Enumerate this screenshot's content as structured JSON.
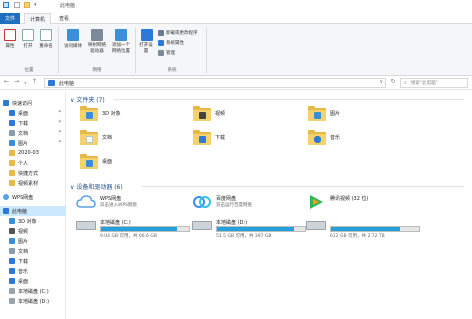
{
  "window": {
    "title": "此电脑"
  },
  "tabs": {
    "file": "文件",
    "computer": "计算机",
    "view": "查看"
  },
  "ribbon": {
    "properties": "属性",
    "open": "打开",
    "rename": "重命名",
    "location_group": "位置",
    "access_media": "访问媒体",
    "map_network_drive": "映射网络驱动器",
    "add_network_location": "添加一个网络位置",
    "network_group": "网络",
    "open_settings": "打开设置",
    "uninstall_programs": "卸载或更改程序",
    "system_properties": "系统属性",
    "manage": "管理",
    "system_group": "系统"
  },
  "address": {
    "path": "此电脑",
    "search_placeholder": "搜索\"此电脑\""
  },
  "sidebar": {
    "items": [
      {
        "label": "快速访问",
        "icon": "star-icon",
        "color": "#2d7ad6"
      },
      {
        "label": "桌面",
        "icon": "desktop-icon",
        "color": "#2d7ad6"
      },
      {
        "label": "下载",
        "icon": "download-icon",
        "color": "#2d7ad6"
      },
      {
        "label": "文档",
        "icon": "document-icon",
        "color": "#8a9bb0"
      },
      {
        "label": "图片",
        "icon": "picture-icon",
        "color": "#3a8fd9"
      },
      {
        "label": "2020-03",
        "icon": "folder-icon",
        "color": "#e8b948"
      },
      {
        "label": "个人",
        "icon": "folder-icon",
        "color": "#e8b948"
      },
      {
        "label": "快捷方式",
        "icon": "folder-icon",
        "color": "#e8b948"
      },
      {
        "label": "视频素材",
        "icon": "folder-icon",
        "color": "#e8b948"
      },
      {
        "label": "WPS网盘",
        "icon": "cloud-icon",
        "color": "#5aa0e6"
      },
      {
        "label": "此电脑",
        "icon": "computer-icon",
        "color": "#2d7ad6"
      },
      {
        "label": "3D 对象",
        "icon": "cube-icon",
        "color": "#3a8fd9"
      },
      {
        "label": "视频",
        "icon": "video-icon",
        "color": "#555555"
      },
      {
        "label": "图片",
        "icon": "picture-icon",
        "color": "#3a8fd9"
      },
      {
        "label": "文档",
        "icon": "document-icon",
        "color": "#8a9bb0"
      },
      {
        "label": "下载",
        "icon": "download-icon",
        "color": "#2d7ad6"
      },
      {
        "label": "音乐",
        "icon": "music-icon",
        "color": "#2d7ad6"
      },
      {
        "label": "桌面",
        "icon": "desktop-icon",
        "color": "#2d7ad6"
      },
      {
        "label": "本地磁盘 (C:)",
        "icon": "drive-icon",
        "color": "#9aa3ad"
      },
      {
        "label": "本地磁盘 (D:)",
        "icon": "drive-icon",
        "color": "#9aa3ad"
      }
    ]
  },
  "folders_section": {
    "header": "文件夹 (7)",
    "items": [
      {
        "label": "3D 对象",
        "icon": "cube-icon",
        "glyph_color": "#3a8fd9"
      },
      {
        "label": "视频",
        "icon": "video-icon",
        "glyph_color": "#444444"
      },
      {
        "label": "图片",
        "icon": "picture-icon",
        "glyph_color": "#3a8fd9"
      },
      {
        "label": "文档",
        "icon": "document-icon",
        "glyph_color": "#b8c4d2"
      },
      {
        "label": "下载",
        "icon": "download-icon",
        "glyph_color": "#2d7ad6"
      },
      {
        "label": "音乐",
        "icon": "music-icon",
        "glyph_color": "#2d7ad6"
      },
      {
        "label": "桌面",
        "icon": "desktop-icon",
        "glyph_color": "#3a8fd9"
      }
    ]
  },
  "devices_section": {
    "header": "设备和驱动器 (6)",
    "clouds": [
      {
        "name": "WPS网盘",
        "sub": "双击进入WPS网盘",
        "icon": "wps-cloud-icon",
        "color": "#5aa0e6"
      },
      {
        "name": "百度网盘",
        "sub": "双击运行百度网盘",
        "icon": "baidu-netdisk-icon",
        "color": "#3b8cff"
      },
      {
        "name": "腾讯视频 (32 位)",
        "sub": "",
        "icon": "tencent-video-icon",
        "color": "#2fb85a"
      }
    ],
    "drives": [
      {
        "name": "本地磁盘 (C:)",
        "info": "9.04 GB 可用，共 66.6 GB",
        "used_fraction": 0.86
      },
      {
        "name": "本地磁盘 (D:)",
        "info": "51.5 GB 可用，共 397 GB",
        "used_fraction": 0.87
      },
      {
        "name": "",
        "info": "612 GB 可用，共 2.72 TB",
        "used_fraction": 0.78
      }
    ]
  },
  "colors": {
    "accent": "#1e6fbf",
    "selection": "#cce8ff",
    "drive_bar": "#26a0da",
    "folder": "#e8b948"
  }
}
